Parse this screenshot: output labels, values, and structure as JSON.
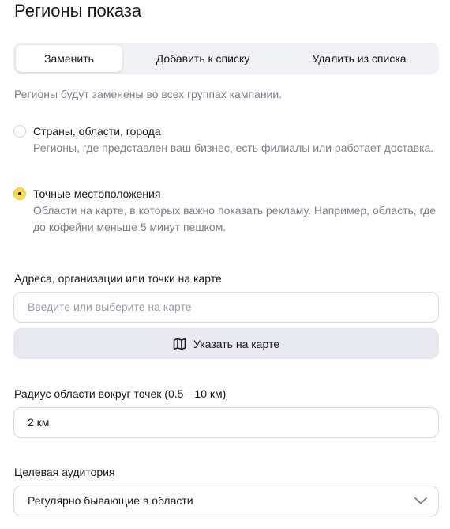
{
  "page": {
    "title": "Регионы показа"
  },
  "tabs": [
    {
      "label": "Заменить",
      "active": true
    },
    {
      "label": "Добавить к списку",
      "active": false
    },
    {
      "label": "Удалить из списка",
      "active": false
    }
  ],
  "hint": "Регионы будут заменены во всех группах кампании.",
  "options": [
    {
      "title": "Страны, области, города",
      "description": "Регионы, где представлен ваш бизнес, есть филиалы или работает доставка.",
      "checked": false
    },
    {
      "title": "Точные местоположения",
      "description": "Области на карте, в которых важно показать рекламу. Например, область, где до кофейни меньше 5 минут пешком.",
      "checked": true
    }
  ],
  "addresses": {
    "label": "Адреса, организации или точки на карте",
    "placeholder": "Введите или выберите на карте",
    "map_button_label": "Указать на карте",
    "map_icon": "map-icon"
  },
  "radius": {
    "label": "Радиус области вокруг точек (0.5—10 км)",
    "value": "2 км"
  },
  "audience": {
    "label": "Целевая аудитория",
    "value": "Регулярно бывающие в области",
    "icon": "chevron-down-icon"
  },
  "colors": {
    "accent": "#ffdb4d",
    "muted_text": "#7b8089",
    "tab_bg": "#f0f1f5",
    "button_bg": "#e8e9f0"
  }
}
